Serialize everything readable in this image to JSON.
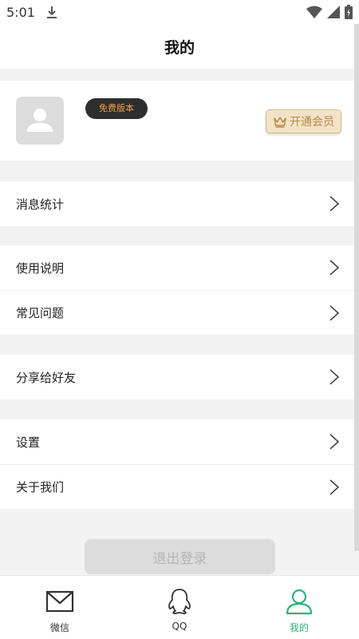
{
  "status_bar": {
    "time": "5:01"
  },
  "header": {
    "title": "我的"
  },
  "profile": {
    "badge": "免费版本",
    "vip_button_label": "开通会员"
  },
  "menu": {
    "group1": [
      {
        "label": "消息统计"
      }
    ],
    "group2": [
      {
        "label": "使用说明"
      },
      {
        "label": "常见问题"
      }
    ],
    "group3": [
      {
        "label": "分享给好友"
      }
    ],
    "group4": [
      {
        "label": "设置"
      },
      {
        "label": "关于我们"
      }
    ]
  },
  "logout_label": "退出登录",
  "tabs": [
    {
      "label": "微信",
      "icon": "mail-icon",
      "active": false
    },
    {
      "label": "QQ",
      "icon": "qq-penguin-icon",
      "active": false
    },
    {
      "label": "我的",
      "icon": "user-icon",
      "active": true
    }
  ],
  "colors": {
    "accent": "#2db47a",
    "badge_text": "#f0a24a",
    "vip_text": "#b88a4a"
  }
}
